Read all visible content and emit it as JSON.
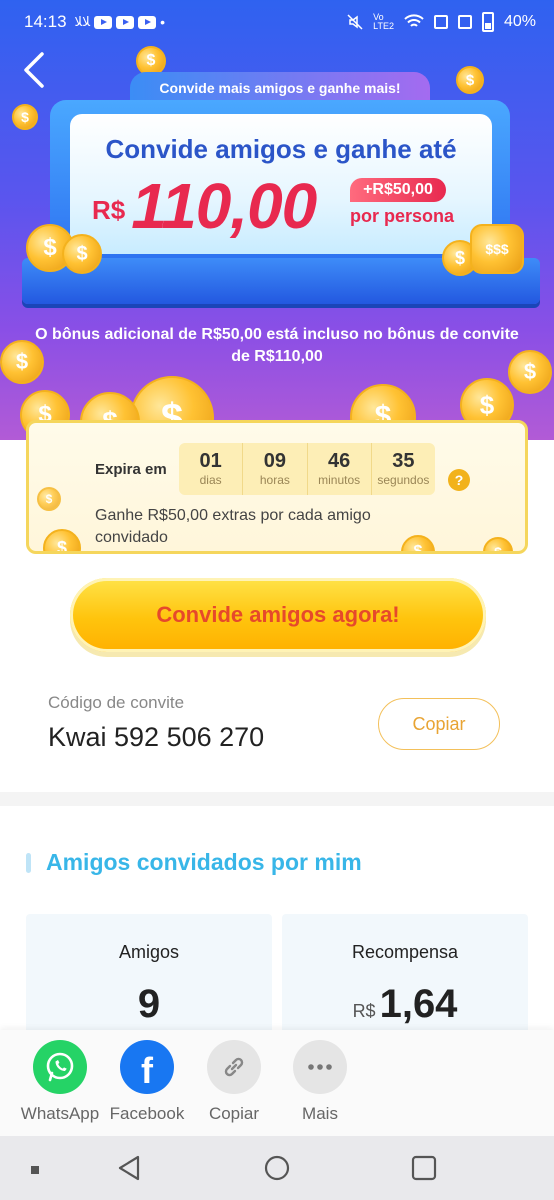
{
  "status_bar": {
    "time": "14:13",
    "battery": "40%"
  },
  "hero": {
    "banner_tag": "Convide mais amigos e ganhe mais!",
    "title": "Convide amigos e ganhe até",
    "currency": "R$",
    "amount": "110,00",
    "extra": "+R$50,00",
    "per_person": "por persona",
    "note": "O bônus adicional de R$50,00 está incluso no bônus de convite de R$110,00"
  },
  "expire": {
    "label": "Expira em",
    "units": [
      {
        "value": "01",
        "unit": "dias"
      },
      {
        "value": "09",
        "unit": "horas"
      },
      {
        "value": "46",
        "unit": "minutos"
      },
      {
        "value": "35",
        "unit": "segundos"
      }
    ],
    "help": "?",
    "text": "Ganhe R$50,00 extras por cada amigo convidado"
  },
  "cta": {
    "label": "Convide amigos agora!"
  },
  "invite": {
    "label": "Código de convite",
    "code": "Kwai 592 506 270",
    "copy_label": "Copiar"
  },
  "friends": {
    "title": "Amigos convidados por mim",
    "stats": {
      "friends_label": "Amigos",
      "friends_value": "9",
      "reward_label": "Recompensa",
      "reward_currency": "R$",
      "reward_value": "1,64"
    }
  },
  "share": {
    "items": [
      {
        "label": "WhatsApp",
        "icon": "whatsapp-icon",
        "color": "#25d366"
      },
      {
        "label": "Facebook",
        "icon": "facebook-icon",
        "color": "#1877f2"
      },
      {
        "label": "Copiar",
        "icon": "link-icon",
        "color": "#e5e5e5"
      },
      {
        "label": "Mais",
        "icon": "more-icon",
        "color": "#e5e5e5"
      }
    ]
  },
  "colors": {
    "accent_red": "#e8294f",
    "accent_blue": "#38b6e8",
    "cta_yellow": "#ffc40d"
  }
}
